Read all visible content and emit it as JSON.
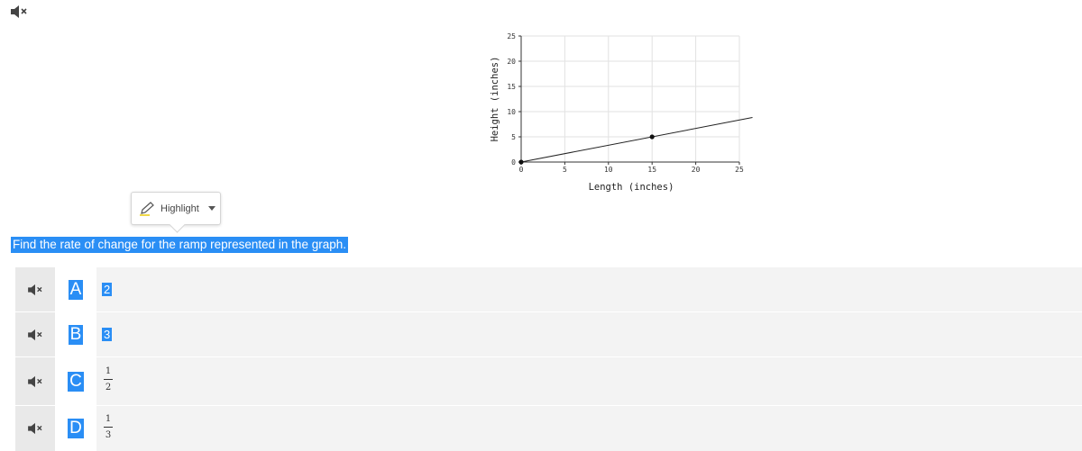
{
  "question": "Find the rate of change for the ramp represented in the graph.",
  "highlight_tool": {
    "label": "Highlight"
  },
  "answers": [
    {
      "letter": "A",
      "text": "2"
    },
    {
      "letter": "B",
      "text": "3"
    },
    {
      "letter": "C",
      "numerator": "1",
      "denominator": "2"
    },
    {
      "letter": "D",
      "numerator": "1",
      "denominator": "3"
    }
  ],
  "colors": {
    "accent": "#2a8ef5",
    "answer_bg": "#f3f3f3",
    "mute_bg": "#e9e9e9"
  },
  "icons": {
    "mute": "speaker-muted-icon",
    "highlight": "pencil-icon",
    "dropdown": "caret-down-icon"
  },
  "chart_data": {
    "type": "line",
    "xlabel": "Length (inches)",
    "ylabel": "Height (inches)",
    "xlim": [
      0,
      25
    ],
    "ylim": [
      0,
      25
    ],
    "xticks": [
      0,
      5,
      10,
      15,
      20,
      25
    ],
    "yticks": [
      0,
      5,
      10,
      15,
      20,
      25
    ],
    "grid": true,
    "series": [
      {
        "x": [
          0,
          26.5
        ],
        "y": [
          0,
          8.83
        ]
      }
    ],
    "points": [
      {
        "x": 0,
        "y": 0
      },
      {
        "x": 15,
        "y": 5
      }
    ]
  }
}
